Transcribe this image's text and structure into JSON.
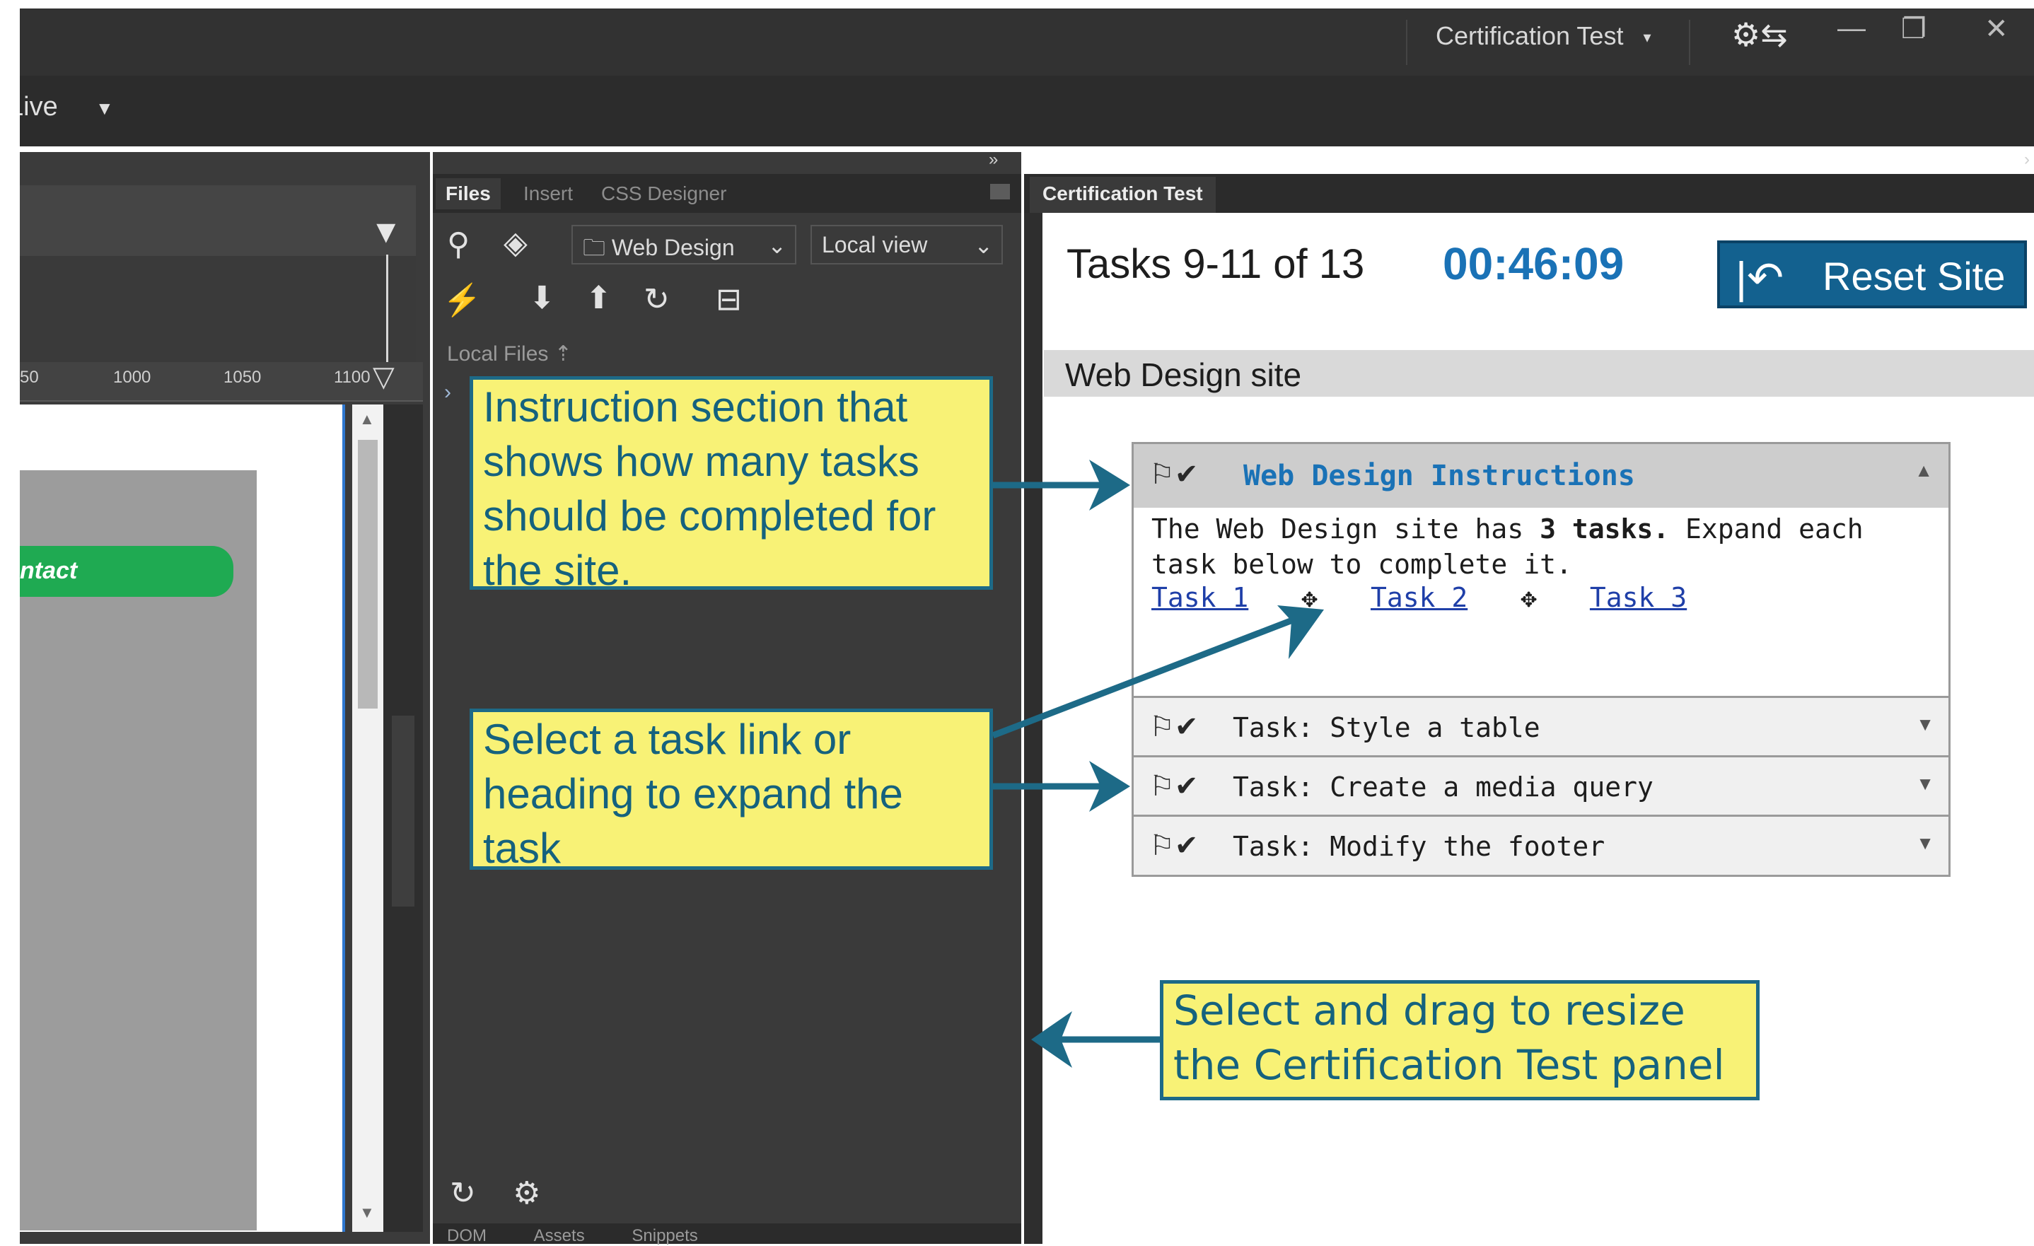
{
  "app": {
    "workspace_label": "Certification Test",
    "view_mode": "Live"
  },
  "window_controls": [
    "minimize-icon",
    "restore-icon",
    "close-icon"
  ],
  "left_panel": {
    "ruler_ticks": [
      "50",
      "1000",
      "1050",
      "1100"
    ],
    "page_button": "ntact"
  },
  "files_panel": {
    "tabs": [
      "Files",
      "Insert",
      "CSS Designer"
    ],
    "site_select": "Web Design",
    "view_select": "Local view",
    "local_files_label": "Local Files",
    "bottom_tabs": [
      "DOM",
      "Assets",
      "Snippets"
    ]
  },
  "cert_panel": {
    "tab_title": "Certification Test",
    "tasks_count": "Tasks 9-11 of 13",
    "timer": "00:46:09",
    "reset_label": "Reset Site",
    "site_heading": "Web Design site",
    "instructions": {
      "title": "Web Design Instructions",
      "text_before": "The Web Design site has",
      "text_bold": "3 tasks.",
      "text_after": "Expand each task below to complete it.",
      "links": [
        "Task 1",
        "Task 2",
        "Task 3"
      ]
    },
    "tasks": [
      "Task: Style a table",
      "Task: Create a media query",
      "Task: Modify the footer"
    ]
  },
  "callouts": {
    "instruction_section": "Instruction section that shows how many tasks should be completed for the site.",
    "select_task": "Select a task link or heading to expand the task",
    "resize_panel": "Select and drag to resize the Certification Test panel"
  },
  "colors": {
    "timer_blue": "#1a72b6",
    "reset_button": "#13618f",
    "callout_fill": "#f8f276",
    "callout_border": "#1d6a87",
    "callout_arrow": "#1d6a87",
    "contact_green": "#1faa52"
  }
}
